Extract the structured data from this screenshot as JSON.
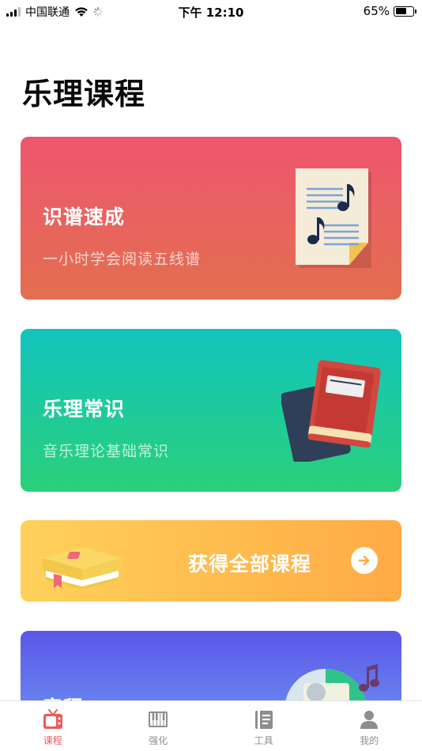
{
  "status_bar": {
    "carrier": "中国联通",
    "time": "下午 12:10",
    "battery_percent": "65%",
    "battery_level": 0.65
  },
  "page": {
    "title": "乐理课程"
  },
  "cards": [
    {
      "title": "识谱速成",
      "subtitle": "一小时学会阅读五线谱",
      "icon": "sheet-music-icon",
      "colors": [
        "#ee566f",
        "#e36f4f"
      ]
    },
    {
      "title": "乐理常识",
      "subtitle": "音乐理论基础常识",
      "icon": "books-icon",
      "colors": [
        "#12c4bd",
        "#2ad07a"
      ]
    }
  ],
  "cta": {
    "label": "获得全部课程",
    "icon": "arrow-right-icon",
    "colors": [
      "#ffd15a",
      "#ffaa45"
    ]
  },
  "partial_card": {
    "title": "音程",
    "icon": "music-disc-icon",
    "colors": [
      "#5b56e8",
      "#6b8ff0"
    ]
  },
  "tab_bar": {
    "active_color": "#ec5a5a",
    "items": [
      {
        "label": "课程",
        "icon": "tv-icon",
        "active": true
      },
      {
        "label": "强化",
        "icon": "piano-icon",
        "active": false
      },
      {
        "label": "工具",
        "icon": "notebook-icon",
        "active": false
      },
      {
        "label": "我的",
        "icon": "user-icon",
        "active": false
      }
    ]
  }
}
